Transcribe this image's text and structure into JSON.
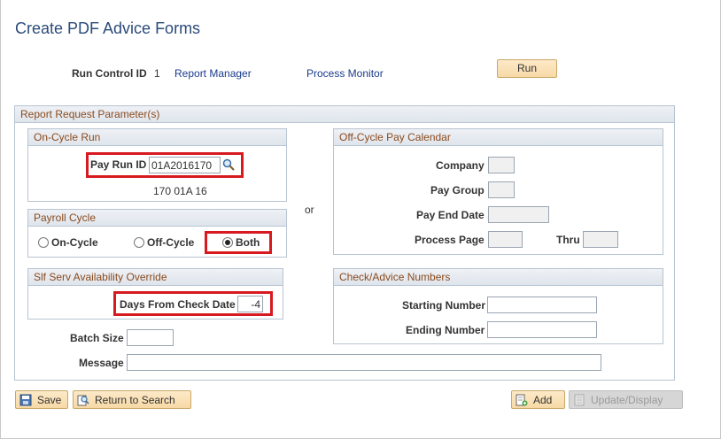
{
  "page": {
    "title": "Create PDF Advice Forms"
  },
  "run_control": {
    "label": "Run Control ID",
    "value": "1",
    "report_manager": "Report Manager",
    "process_monitor": "Process Monitor",
    "run_button": "Run"
  },
  "report_request": {
    "title": "Report Request Parameter(s)",
    "on_cycle": {
      "title": "On-Cycle Run",
      "pay_run_id_label": "Pay Run ID",
      "pay_run_id_value": "01A2016170",
      "pay_run_desc": "170 01A 16"
    },
    "or_label": "or",
    "payroll_cycle": {
      "title": "Payroll Cycle",
      "options": [
        "On-Cycle",
        "Off-Cycle",
        "Both"
      ],
      "selected": "Both"
    },
    "slf_serv": {
      "title": "Slf Serv Availability Override",
      "days_label": "Days From Check Date",
      "days_value": "-4"
    },
    "off_cycle": {
      "title": "Off-Cycle Pay Calendar",
      "company_label": "Company",
      "pay_group_label": "Pay Group",
      "pay_end_date_label": "Pay End Date",
      "process_page_label": "Process Page",
      "thru_label": "Thru"
    },
    "check_advice": {
      "title": "Check/Advice Numbers",
      "starting_label": "Starting Number",
      "ending_label": "Ending Number"
    },
    "batch_size_label": "Batch Size",
    "message_label": "Message"
  },
  "toolbar": {
    "save": "Save",
    "return_to_search": "Return to Search",
    "add": "Add",
    "update_display": "Update/Display"
  },
  "colors": {
    "highlight": "#d71920",
    "title": "#2b4b7a",
    "group_header_text": "#8a4a1e"
  }
}
